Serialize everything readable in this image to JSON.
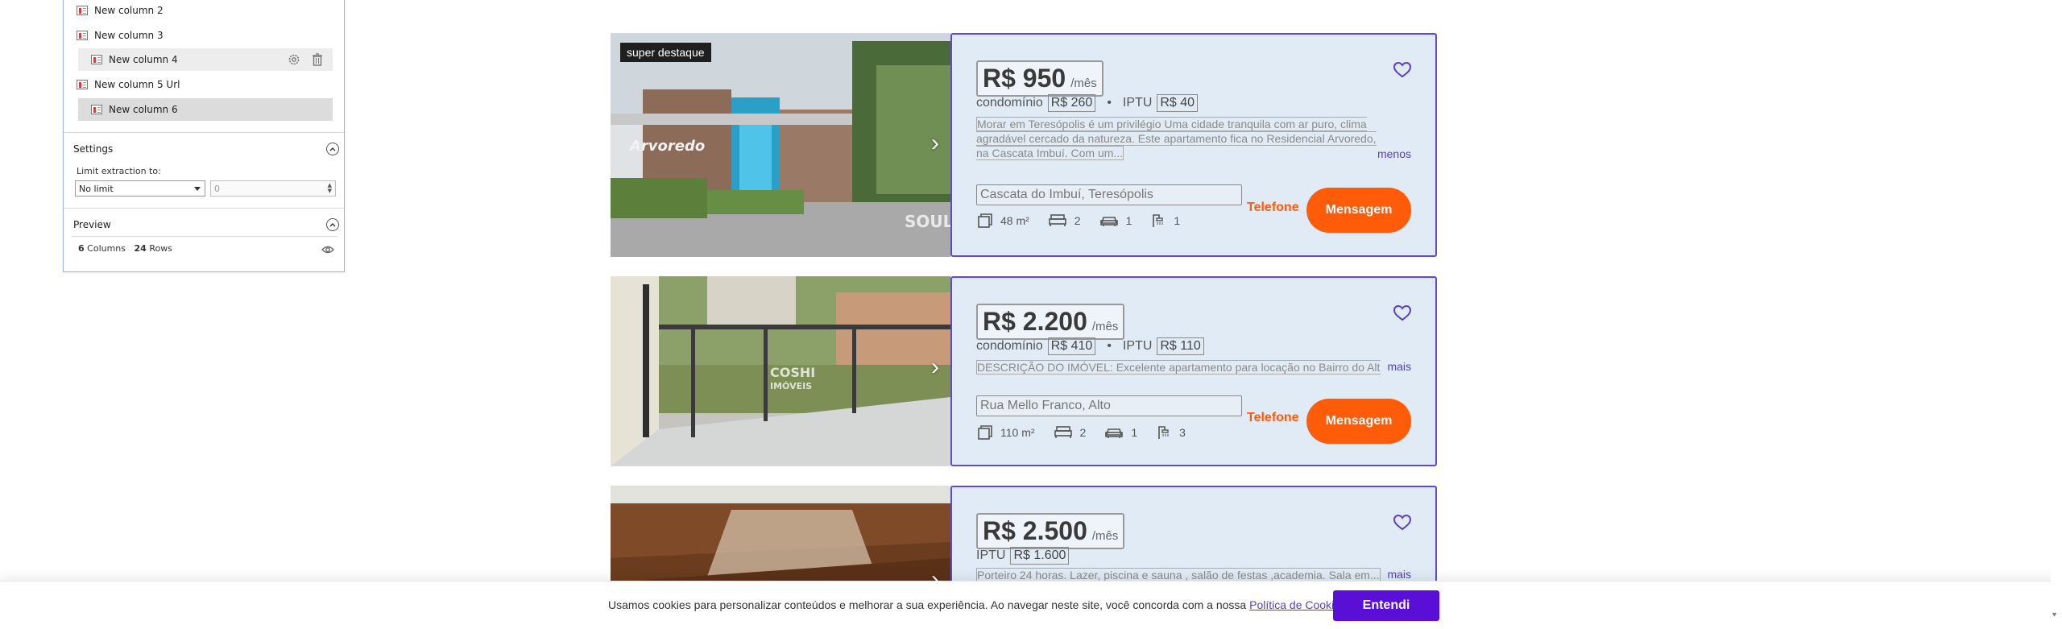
{
  "panel": {
    "columns": [
      {
        "label": "New column 2"
      },
      {
        "label": "New column 3"
      },
      {
        "label": "New column 4"
      },
      {
        "label": "New column 5 Url"
      },
      {
        "label": "New column 6"
      }
    ],
    "settings_title": "Settings",
    "limit_label": "Limit extraction to:",
    "limit_select": "No limit",
    "limit_count": "0",
    "preview_title": "Preview",
    "columns_count": "6",
    "columns_word": "Columns",
    "rows_count": "24",
    "rows_word": "Rows"
  },
  "listings": [
    {
      "badge": "super destaque",
      "price": "R$ 950",
      "unit": "/mês",
      "condo_label": "condomínio",
      "condo": "R$ 260",
      "iptu_label": "IPTU",
      "iptu": "R$ 40",
      "description": "Morar em Teresópolis é um privilégio Uma cidade tranquila com ar puro, clima agradável cercado da natureza. Este apartamento fica no Residencial Arvoredo, na Cascata Imbuí. Com um...",
      "toggle": "menos",
      "address": "Cascata do Imbuí, Teresópolis",
      "area": "48 m²",
      "bedrooms": "2",
      "parking": "1",
      "bathrooms": "1",
      "phone": "Telefone",
      "message": "Mensagem",
      "watermark": "SOUL",
      "sign": "Arvoredo"
    },
    {
      "price": "R$ 2.200",
      "unit": "/mês",
      "condo_label": "condomínio",
      "condo": "R$ 410",
      "iptu_label": "IPTU",
      "iptu": "R$ 110",
      "description": "DESCRIÇÃO DO IMÓVEL: Excelente apartamento para locação no Bairro do Alto...",
      "toggle": "mais",
      "address": "Rua Mello Franco, Alto",
      "area": "110 m²",
      "bedrooms": "2",
      "parking": "1",
      "bathrooms": "3",
      "phone": "Telefone",
      "message": "Mensagem",
      "watermark": "COSHI",
      "watermark_sub": "IMÓVEIS"
    },
    {
      "price": "R$ 2.500",
      "unit": "/mês",
      "iptu_label": "IPTU",
      "iptu": "R$ 1.600",
      "description": "Porteiro 24 horas. Lazer, piscina e sauna , salão de festas ,academia. Sala em...",
      "toggle": "mais"
    }
  ],
  "cookie": {
    "text": "Usamos cookies para personalizar conteúdos e melhorar a sua experiência. Ao navegar neste site, você concorda com a nossa ",
    "link": "Política de Cookies",
    "period": ".",
    "accept": "Entendi"
  },
  "colors": {
    "accent": "#5a0fd6",
    "card_border": "#5c4bd8",
    "cta": "#ff5c0a",
    "card_bg": "#e0ebf5"
  }
}
